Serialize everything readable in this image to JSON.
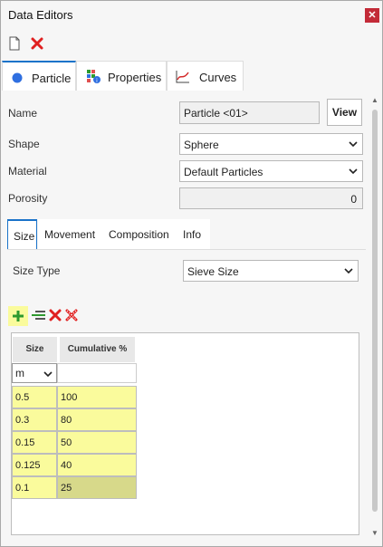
{
  "window": {
    "title": "Data Editors",
    "close_icon": "close-icon"
  },
  "toolbar": {
    "new_icon": "document-icon",
    "delete_icon": "delete-icon"
  },
  "main_tabs": [
    {
      "label": "Particle",
      "icon": "circle-icon",
      "active": true
    },
    {
      "label": "Properties",
      "icon": "properties-icon",
      "active": false
    },
    {
      "label": "Curves",
      "icon": "curve-chart-icon",
      "active": false
    }
  ],
  "form": {
    "name_label": "Name",
    "name_value": "Particle <01>",
    "view_button": "View",
    "shape_label": "Shape",
    "shape_value": "Sphere",
    "material_label": "Material",
    "material_value": "Default Particles",
    "porosity_label": "Porosity",
    "porosity_value": "0"
  },
  "sub_tabs": [
    {
      "label": "Size",
      "active": true
    },
    {
      "label": "Movement",
      "active": false
    },
    {
      "label": "Composition",
      "active": false
    },
    {
      "label": "Info",
      "active": false
    }
  ],
  "size": {
    "size_type_label": "Size Type",
    "size_type_value": "Sieve Size",
    "actions": [
      "add-row-icon",
      "insert-row-icon",
      "delete-row-icon",
      "delete-all-icon"
    ],
    "columns": [
      "Size",
      "Cumulative %"
    ],
    "unit": "m",
    "rows": [
      {
        "size": "0.5",
        "cumulative": "100"
      },
      {
        "size": "0.3",
        "cumulative": "80"
      },
      {
        "size": "0.15",
        "cumulative": "50"
      },
      {
        "size": "0.125",
        "cumulative": "40"
      },
      {
        "size": "0.1",
        "cumulative": "25"
      }
    ]
  },
  "colors": {
    "accent": "#1a73c9",
    "close_red": "#c32b38",
    "cell_yellow": "#fafb9c",
    "add_green": "#2e9a2e",
    "delete_red": "#e02020"
  }
}
